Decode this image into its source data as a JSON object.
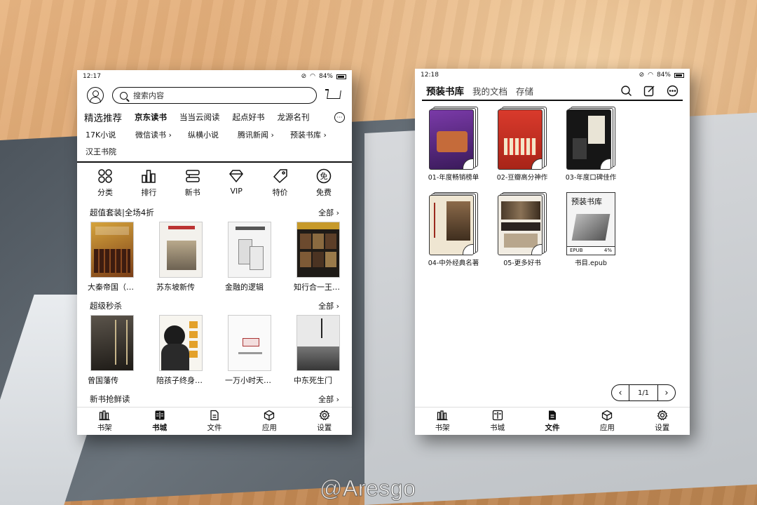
{
  "left": {
    "status": {
      "time": "12:17",
      "battery": "84%"
    },
    "search_placeholder": "搜索内容",
    "source_tabs": [
      {
        "label": "精选推荐"
      },
      {
        "label": "京东读书"
      },
      {
        "label": "当当云阅读"
      },
      {
        "label": "起点好书"
      },
      {
        "label": "龙源名刊"
      }
    ],
    "more_label": "···",
    "sub_sources": [
      "17K小说",
      "微信读书 ›",
      "纵横小说",
      "腾讯新闻 ›",
      "预装书库 ›",
      "汉王书院"
    ],
    "categories": [
      {
        "label": "分类",
        "icon": "grid-icon"
      },
      {
        "label": "排行",
        "icon": "ranking-icon"
      },
      {
        "label": "新书",
        "icon": "new-book-icon"
      },
      {
        "label": "VIP",
        "icon": "diamond-icon"
      },
      {
        "label": "特价",
        "icon": "tag-icon"
      },
      {
        "label": "免费",
        "icon": "free-icon",
        "glyph": "免"
      }
    ],
    "sections": [
      {
        "title": "超值套装|全场4折",
        "all_label": "全部 ›",
        "books": [
          {
            "title": "大秦帝国（全套）",
            "cover": "#b7812a"
          },
          {
            "title": "苏东坡新传",
            "cover": "#d9d2c4"
          },
          {
            "title": "金融的逻辑",
            "cover": "#e8e8e8"
          },
          {
            "title": "知行合一王阳明",
            "cover": "#2f2a24"
          }
        ]
      },
      {
        "title": "超级秒杀",
        "all_label": "全部 ›",
        "books": [
          {
            "title": "曾国藩传",
            "cover": "#3b3630"
          },
          {
            "title": "陪孩子终身成长",
            "cover": "#f1efe9"
          },
          {
            "title": "一万小时天才理论",
            "cover": "#f6f6f6"
          },
          {
            "title": "中东死生门",
            "cover": "#bdbdbd"
          }
        ]
      },
      {
        "title": "新书抢鲜读",
        "all_label": "全部 ›"
      }
    ],
    "nav": [
      {
        "label": "书架",
        "icon": "bookshelf-icon"
      },
      {
        "label": "书城",
        "icon": "bookstore-icon",
        "active": true
      },
      {
        "label": "文件",
        "icon": "file-icon"
      },
      {
        "label": "应用",
        "icon": "apps-icon"
      },
      {
        "label": "设置",
        "icon": "settings-icon"
      }
    ]
  },
  "right": {
    "status": {
      "time": "12:18",
      "battery": "84%"
    },
    "tabs": [
      {
        "label": "预装书库",
        "active": true
      },
      {
        "label": "我的文档"
      },
      {
        "label": "存储"
      }
    ],
    "folders": [
      {
        "label": "01-年度畅销榜单",
        "cover": "#5b2a8a"
      },
      {
        "label": "02-豆瓣高分神作",
        "cover": "#c8352a"
      },
      {
        "label": "03-年度口碑佳作",
        "cover": "#1d1d1d"
      },
      {
        "label": "04-中外经典名著",
        "cover": "#d8cdb6"
      },
      {
        "label": "05-更多好书",
        "cover": "#6d5a44"
      }
    ],
    "file": {
      "label": "书目.epub",
      "format": "EPUB",
      "progress": "4%",
      "cover_title": "预装书库"
    },
    "pager": {
      "prev": "‹",
      "page": "1/1",
      "next": "›"
    },
    "nav": [
      {
        "label": "书架",
        "icon": "bookshelf-icon"
      },
      {
        "label": "书城",
        "icon": "bookstore-icon"
      },
      {
        "label": "文件",
        "icon": "file-icon",
        "active": true
      },
      {
        "label": "应用",
        "icon": "apps-icon"
      },
      {
        "label": "设置",
        "icon": "settings-icon"
      }
    ]
  },
  "watermark": "@Aresgo"
}
